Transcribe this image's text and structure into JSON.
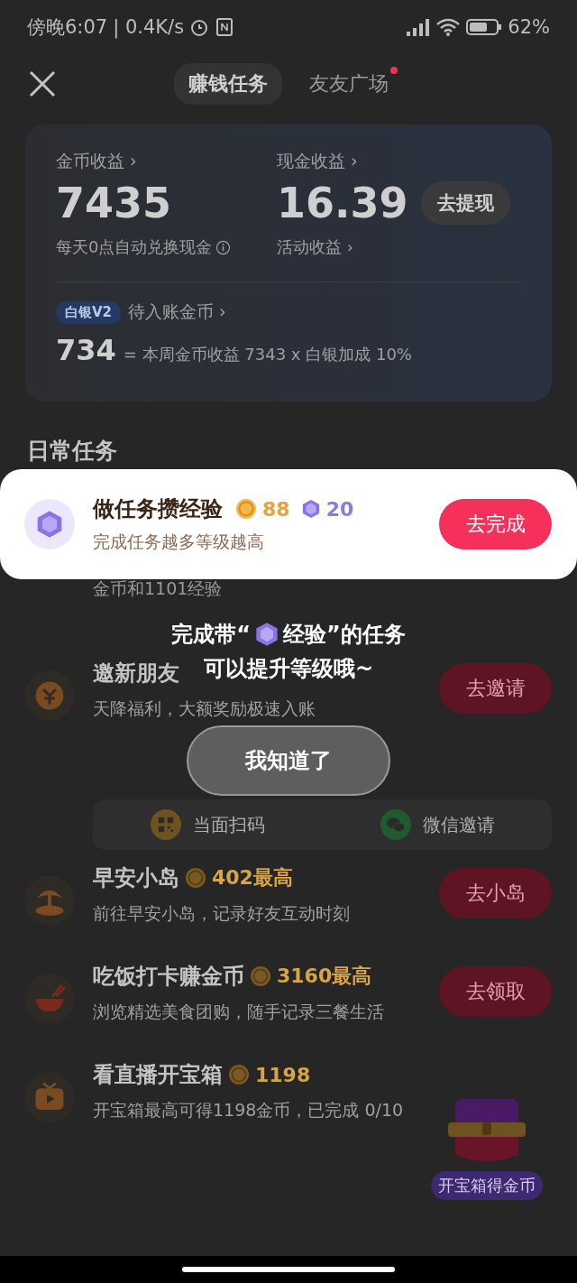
{
  "status_bar": {
    "time": "傍晚6:07",
    "speed": "| 0.4K/s",
    "battery": "62%"
  },
  "header": {
    "tabs": [
      {
        "label": "赚钱任务",
        "selected": true,
        "dot": false
      },
      {
        "label": "友友广场",
        "selected": false,
        "dot": true
      }
    ]
  },
  "earnings": {
    "coin_label": "金币收益 ›",
    "coin_value": "7435",
    "coin_note": "每天0点自动兑换现金",
    "cash_label": "现金收益 ›",
    "cash_value": "16.39",
    "withdraw_button": "去提现",
    "cash_note": "活动收益 ›",
    "level_badge": "白银V2",
    "pending_label": "待入账金币 ›",
    "pending_value": "734",
    "formula": "= 本周金币收益 7343 x 白银加成 10%"
  },
  "section_title": "日常任务",
  "highlight_task": {
    "title": "做任务攒经验",
    "coins": "88",
    "exp": "20",
    "desc": "完成任务越多等级越高",
    "button": "去完成"
  },
  "hidden_task_fragment": "金币和1101经验",
  "guide": {
    "line1_before": "完成带“",
    "line1_after": "经验”的任务",
    "line2": "可以提升等级哦~",
    "button": "我知道了"
  },
  "tasks": [
    {
      "kind": "invite",
      "title": "邀新朋友",
      "desc": "天降福利，大额奖励极速入账",
      "button": "去邀请",
      "share": [
        {
          "kind": "qr",
          "label": "当面扫码"
        },
        {
          "kind": "wechat",
          "label": "微信邀请"
        }
      ]
    },
    {
      "kind": "island",
      "title": "早安小岛",
      "reward": "402最高",
      "desc": "前往早安小岛，记录好友互动时刻",
      "button": "去小岛"
    },
    {
      "kind": "meal",
      "title": "吃饭打卡赚金币",
      "reward": "3160最高",
      "desc": "浏览精选美食团购，随手记录三餐生活",
      "button": "去领取"
    },
    {
      "kind": "live",
      "title": "看直播开宝箱",
      "reward": "1198",
      "desc": "开宝箱最高可得1198金币，已完成 0/10"
    }
  ],
  "floating_chest": {
    "label": "开宝箱得金币"
  }
}
